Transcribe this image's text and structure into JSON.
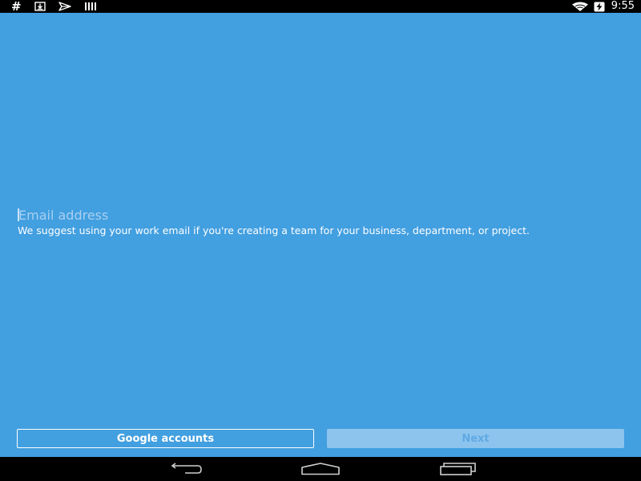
{
  "status_bar": {
    "time": "9:55",
    "left_icons": [
      "hash-icon",
      "download-icon",
      "send-icon",
      "barcode-icon"
    ],
    "right_icons": [
      "wifi-icon",
      "battery-charging-icon"
    ]
  },
  "form": {
    "email_placeholder": "Email address",
    "email_value": "",
    "hint": "We suggest using your work email if you're creating a team for your business, department, or project."
  },
  "buttons": {
    "google_label": "Google accounts",
    "next_label": "Next",
    "next_enabled": false
  },
  "nav_bar": {
    "icons": [
      "back-icon",
      "home-icon",
      "recents-icon"
    ]
  },
  "colors": {
    "background": "#429fe0",
    "next_disabled_bg": "#8cc4ee",
    "next_disabled_text": "#5fa9e4"
  }
}
